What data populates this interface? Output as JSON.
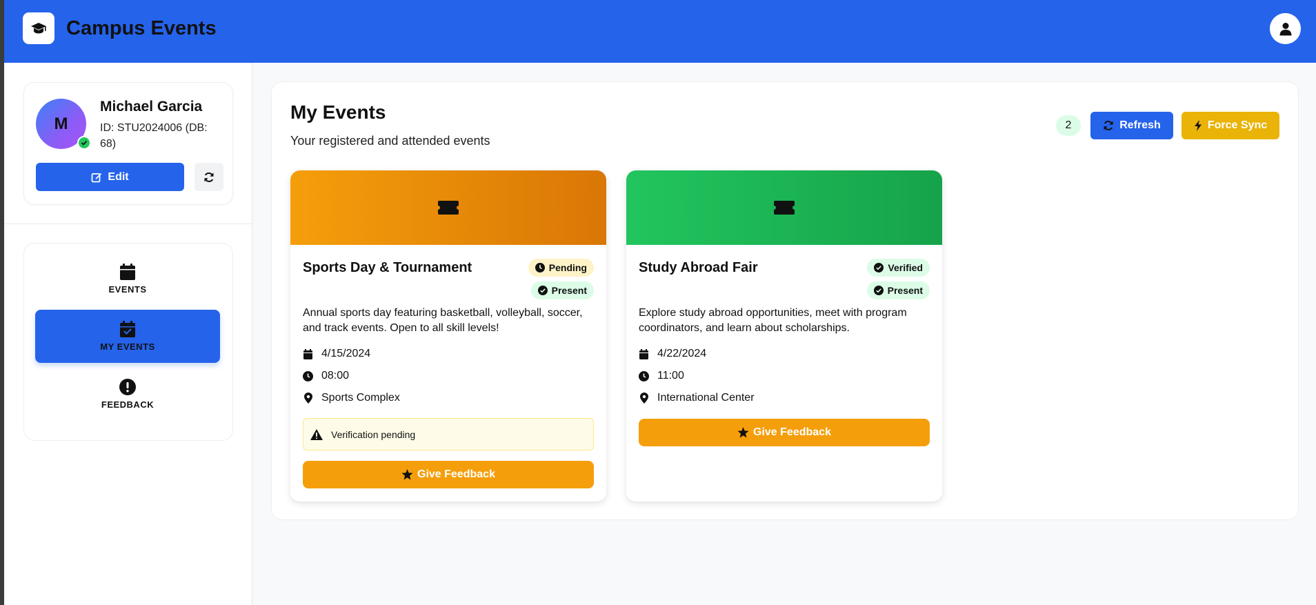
{
  "app": {
    "title": "Campus Events"
  },
  "profile": {
    "initial": "M",
    "name": "Michael Garcia",
    "id_text": "ID: STU2024006 (DB: 68)",
    "edit_label": "Edit"
  },
  "nav": {
    "items": [
      {
        "label": "EVENTS",
        "icon": "calendar-icon",
        "active": false
      },
      {
        "label": "MY EVENTS",
        "icon": "calendar-check-icon",
        "active": true
      },
      {
        "label": "FEEDBACK",
        "icon": "exclamation-circle-icon",
        "active": false
      }
    ]
  },
  "main": {
    "title": "My Events",
    "subtitle": "Your registered and attended events",
    "count": "2",
    "refresh_label": "Refresh",
    "sync_label": "Force Sync"
  },
  "events": [
    {
      "title": "Sports Day & Tournament",
      "status": "Pending",
      "attendance": "Present",
      "description": "Annual sports day featuring basketball, volleyball, soccer, and track events. Open to all skill levels!",
      "date": "4/15/2024",
      "time": "08:00",
      "location": "Sports Complex",
      "warning": "Verification pending",
      "feedback_label": "Give Feedback",
      "banner_color": "#f59e0b"
    },
    {
      "title": "Study Abroad Fair",
      "status": "Verified",
      "attendance": "Present",
      "description": "Explore study abroad opportunities, meet with program coordinators, and learn about scholarships.",
      "date": "4/22/2024",
      "time": "11:00",
      "location": "International Center",
      "feedback_label": "Give Feedback",
      "banner_color": "#22c55e"
    }
  ],
  "colors": {
    "primary": "#2563eb",
    "warning": "#f59e0b",
    "sync": "#eab308",
    "success": "#22c55e"
  }
}
